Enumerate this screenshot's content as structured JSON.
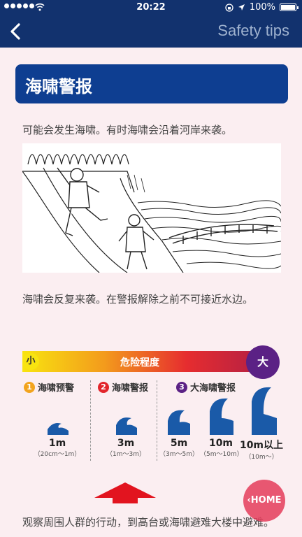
{
  "status_bar": {
    "time": "20:22",
    "battery": "100%",
    "battery_level": 1.0
  },
  "nav": {
    "title": "Safety tips",
    "back_icon": "chevron-left-icon"
  },
  "heading": "海啸警报",
  "paragraph1": "可能会发生海啸。有时海啸会沿着河岸来袭。",
  "paragraph2": "海啸会反复来袭。在警报解除之前不可接近水边。",
  "scale": {
    "small": "小",
    "large": "大",
    "label": "危险程度"
  },
  "levels": [
    {
      "number": "1",
      "name": "海啸预警",
      "color": "#f2a41e"
    },
    {
      "number": "2",
      "name": "海啸警报",
      "color": "#e2252b"
    },
    {
      "number": "3",
      "name": "大海啸警报",
      "color": "#5b2185"
    }
  ],
  "wave_heights": [
    {
      "height": "1m",
      "range": "（20cm〜1m）"
    },
    {
      "height": "3m",
      "range": "（1m〜3m）"
    },
    {
      "height": "5m",
      "range": "（3m〜5m）"
    },
    {
      "height": "10m",
      "range": "（5m〜10m）"
    },
    {
      "height": "10m以上",
      "range": "（10m〜）"
    }
  ],
  "paragraph3": "观察周围人群的行动，到高台或海啸避难大楼中避难。",
  "home_button": "HOME",
  "colors": {
    "header_bg": "#12326e",
    "heading_bg": "#0e3e91",
    "wave": "#1a5aa8",
    "arrow_up": "#e2141f",
    "home": "#e43c5a"
  }
}
